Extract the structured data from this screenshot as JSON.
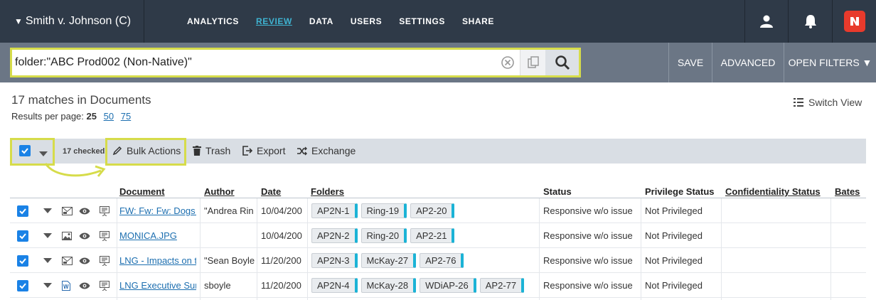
{
  "case": {
    "title": "Smith v. Johnson (C)",
    "caret": "▼"
  },
  "nav": {
    "items": [
      "ANALYTICS",
      "REVIEW",
      "DATA",
      "USERS",
      "SETTINGS",
      "SHARE"
    ],
    "active": "REVIEW"
  },
  "icons": {
    "user": "user-icon",
    "bell": "bell-icon",
    "brand": "brand-logo-icon"
  },
  "search": {
    "query": "folder:\"ABC Prod002 (Non-Native)\"",
    "buttons": {
      "save": "SAVE",
      "advanced": "ADVANCED",
      "open_filters": "OPEN FILTERS ▼"
    }
  },
  "summary": {
    "matches": "17 matches in Documents",
    "per_page_label": "Results per page:",
    "per_page_options": [
      "25",
      "50",
      "75"
    ],
    "switch_view": "Switch View"
  },
  "toolbar": {
    "checked_count": "17 checked",
    "bulk_actions": "Bulk Actions",
    "trash": "Trash",
    "export": "Export",
    "exchange": "Exchange"
  },
  "table": {
    "headers": {
      "document": "Document",
      "author": "Author",
      "date": "Date",
      "folders": "Folders",
      "status": "Status",
      "privilege": "Privilege Status",
      "confidentiality": "Confidentiality Status",
      "bates": "Bates"
    },
    "rows": [
      {
        "type_icon": "email-icon",
        "document": "FW: Fw: Fw: Dogs a",
        "author": "\"Andrea Rin",
        "date": "10/04/200",
        "folders": [
          "AP2N-1",
          "Ring-19",
          "AP2-20"
        ],
        "status": "Responsive w/o issue",
        "privilege": "Not Privileged",
        "confidentiality": "",
        "bates": ""
      },
      {
        "type_icon": "image-icon",
        "document": "MONICA.JPG",
        "author": "",
        "date": "10/04/200",
        "folders": [
          "AP2N-2",
          "Ring-20",
          "AP2-21"
        ],
        "status": "Responsive w/o issue",
        "privilege": "Not Privileged",
        "confidentiality": "",
        "bates": ""
      },
      {
        "type_icon": "email-icon",
        "document": "LNG - Impacts on t",
        "author": "\"Sean Boyle",
        "date": "11/20/200",
        "folders": [
          "AP2N-3",
          "McKay-27",
          "AP2-76"
        ],
        "status": "Responsive w/o issue",
        "privilege": "Not Privileged",
        "confidentiality": "",
        "bates": ""
      },
      {
        "type_icon": "word-doc-icon",
        "document": "LNG Executive Sun",
        "author": "sboyle",
        "date": "11/20/200",
        "folders": [
          "AP2N-4",
          "McKay-28",
          "WDiAP-26",
          "AP2-77"
        ],
        "status": "Responsive w/o issue",
        "privilege": "Not Privileged",
        "confidentiality": "",
        "bates": ""
      }
    ]
  },
  "colors": {
    "nav_bg": "#2f3a48",
    "search_bg": "#6b7685",
    "accent": "#3fb3d1",
    "highlight": "#d6dc4a",
    "checkbox": "#1a82e6",
    "tag_stripe": "#1bb3d6",
    "brand": "#e83a2c"
  }
}
